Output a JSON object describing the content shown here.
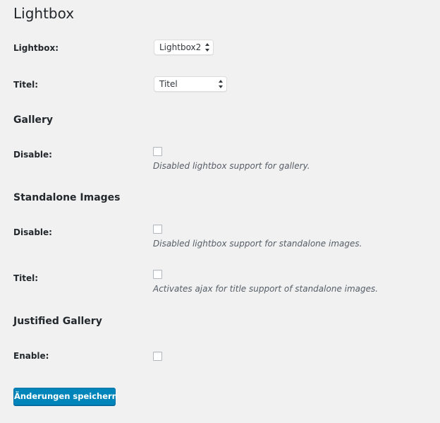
{
  "page": {
    "title": "Lightbox"
  },
  "lightbox_row": {
    "label": "Lightbox:",
    "selected": "Lightbox2"
  },
  "titel_row": {
    "label": "Titel:",
    "selected": "Titel"
  },
  "gallery": {
    "heading": "Gallery",
    "disable_label": "Disable:",
    "disable_checked": false,
    "disable_description": "Disabled lightbox support for gallery."
  },
  "standalone": {
    "heading": "Standalone Images",
    "disable_label": "Disable:",
    "disable_checked": false,
    "disable_description": "Disabled lightbox support for standalone images.",
    "titel_label": "Titel:",
    "titel_checked": false,
    "titel_description": "Activates ajax for title support of standalone images."
  },
  "justified": {
    "heading": "Justified Gallery",
    "enable_label": "Enable:",
    "enable_checked": false
  },
  "actions": {
    "save_label": "Änderungen speichern"
  },
  "colors": {
    "background": "#f1f1f1",
    "primary_button": "#0085ba",
    "text": "#23282d",
    "description": "#555d66"
  },
  "icons": {
    "select_arrows": "up-down-arrows-icon"
  }
}
